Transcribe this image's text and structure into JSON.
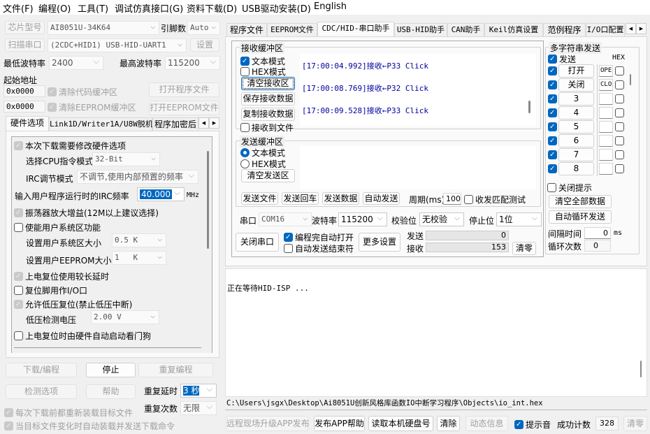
{
  "menu": [
    "文件(F)",
    "编程(O)",
    "工具(T)",
    "调试仿真接口(G)",
    "资料下载(D)",
    "USB驱动安装(D)",
    "English"
  ],
  "left": {
    "chip_type_btn": "芯片型号",
    "chip_type": "AI8051U-34K64",
    "pins_label": "引脚数",
    "pins": "Auto",
    "scan_port_btn": "扫描串口",
    "port": "(2CDC+HID1) USB-HID-UART1",
    "settings_btn": "设置",
    "min_baud_label": "最低波特率",
    "min_baud": "2400",
    "max_baud_label": "最高波特率",
    "max_baud": "115200",
    "start_addr_label": "起始地址",
    "code_addr": "0x0000",
    "eeprom_addr": "0x0000",
    "clear_code": "清除代码缓冲区",
    "clear_eeprom": "清除EEPROM缓冲区",
    "open_prog": "打开程序文件",
    "open_eeprom": "打开EEPROM文件",
    "tabs": [
      "硬件选项",
      "Link1D/Writer1A/U8W脱机",
      "程序加密后"
    ],
    "hw": {
      "modify": "本次下载需要修改硬件选项",
      "cpu_mode_label": "选择CPU指令模式",
      "cpu_mode": "32-Bit",
      "irc_mode_label": "IRC调节模式",
      "irc_mode": "不调节,使用内部预置的频率",
      "irc_freq_label": "输入用户程序运行时的IRC频率",
      "irc_freq": "40.000",
      "mhz": "MHz",
      "osc_gain": "振荡器放大增益(12M以上建议选择)",
      "user_sys": "使能用户系统区功能",
      "user_sys_size_label": "设置用户系统区大小",
      "user_sys_size": "0.5 K",
      "user_eeprom_label": "设置用户EEPROM大小",
      "user_eeprom": "1   K",
      "long_delay": "上电复位使用较长延时",
      "reset_io": "复位脚用作I/O口",
      "lvr": "允许低压复位(禁止低压中断)",
      "lvd_label": "低压检测电压",
      "lvd": "2.00 V",
      "wdt": "上电复位时由硬件自动启动看门狗"
    },
    "download_btn": "下载/编程",
    "stop_btn": "停止",
    "repeat_btn": "重复编程",
    "check_btn": "检测选项",
    "help_btn": "帮助",
    "repeat_delay_label": "重复延时",
    "repeat_delay": "3 秒",
    "repeat_count_label": "重复次数",
    "repeat_count": "无限",
    "reload_each": "每次下载前都重新装载目标文件",
    "auto_reload": "当目标文件变化时自动装载并发送下载命令"
  },
  "right": {
    "tabs": [
      "程序文件",
      "EEPROM文件",
      "CDC/HID-串口助手",
      "USB-HID助手",
      "CAN助手",
      "Keil仿真设置",
      "范例程序",
      "I/O口配置"
    ],
    "recv": {
      "title": "接收缓冲区",
      "text_mode": "文本模式",
      "hex_mode": "HEX模式",
      "clear": "清空接收区",
      "save": "保存接收数据",
      "copy": "复制接收数据",
      "to_file": "接收到文件",
      "lines": [
        "[17:00:04.992]接收←P33 Click",
        "[17:00:08.769]接收←P32 Click",
        "[17:00:09.528]接收←P33 Click"
      ]
    },
    "send": {
      "title": "发送缓冲区",
      "text_mode": "文本模式",
      "hex_mode": "HEX模式",
      "clear": "清空发送区",
      "send_file": "发送文件",
      "send_enter": "发送回车",
      "send_data": "发送数据",
      "auto_send": "自动发送",
      "period_label": "周期(ms)",
      "period": "100",
      "match_test": "收发匹配测试"
    },
    "port_label": "串口",
    "port": "COM16",
    "baud_label": "波特率",
    "baud": "115200",
    "parity_label": "校验位",
    "parity": "无校验",
    "stop_label": "停止位",
    "stop": "1位",
    "close_port": "关闭串口",
    "auto_open": "编程完自动打开",
    "auto_end": "自动发送结束符",
    "more": "更多设置",
    "sent_label": "发送",
    "sent": "0",
    "recv_label": "接收",
    "recv_count": "153",
    "clear_count": "清零",
    "multi": {
      "title": "多字符串发送",
      "send": "发送",
      "hex": "HEX",
      "rows": [
        {
          "label": "打开",
          "text": "OPE"
        },
        {
          "label": "关闭",
          "text": "CLO"
        },
        {
          "label": "3",
          "text": ""
        },
        {
          "label": "4",
          "text": ""
        },
        {
          "label": "5",
          "text": ""
        },
        {
          "label": "6",
          "text": ""
        },
        {
          "label": "7",
          "text": ""
        },
        {
          "label": "8",
          "text": ""
        }
      ],
      "close_tip": "关闭提示",
      "clear_all": "清空全部数据",
      "auto_loop": "自动循环发送",
      "interval_label": "间隔时间",
      "interval": "0",
      "ms": "ms",
      "loop_label": "循环次数",
      "loop": "0"
    },
    "log": "正在等待HID-ISP ...",
    "path": "C:\\Users\\jsgx\\Desktop\\Ai8051U创新风格库函数IO中断学习程序\\Objects\\io_int.hex",
    "bottom": {
      "remote": "远程现场升级APP发布",
      "publish_help": "发布APP帮助",
      "read_disk": "读取本机硬盘号",
      "clear": "清除",
      "dyn": "动态信息",
      "beep": "提示音",
      "success_label": "成功计数",
      "success": "328",
      "reset": "清零"
    }
  }
}
